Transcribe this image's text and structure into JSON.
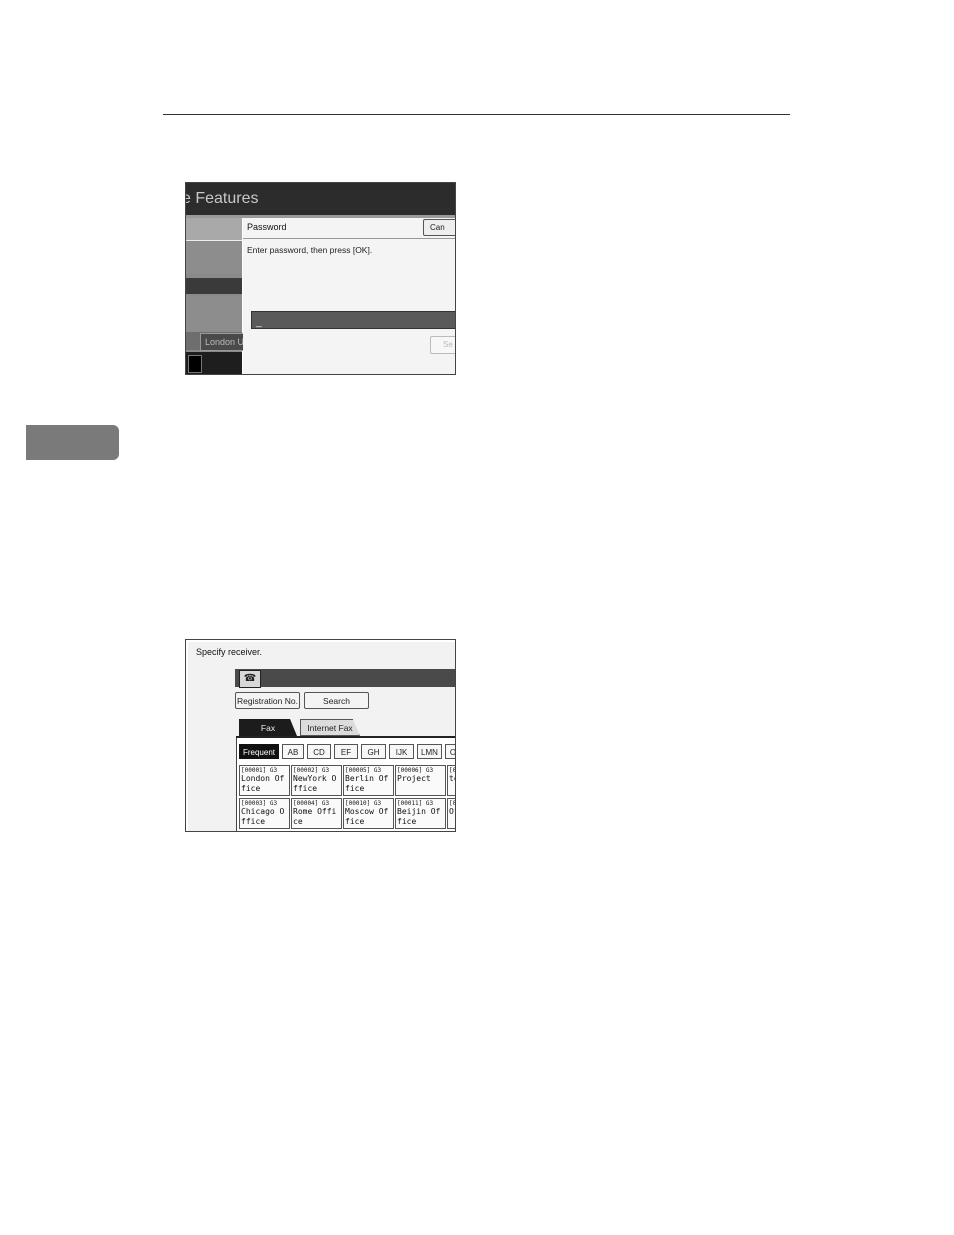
{
  "screenshot1": {
    "title": "e Features",
    "left_item": "London U",
    "dialog_title": "Password",
    "cancel_label": "Can",
    "prompt": "Enter password, then press [OK].",
    "input_value": "_",
    "secondary_button": "Se"
  },
  "screenshot2": {
    "instruction": "Specify receiver.",
    "fax_icon": "fax-machine-icon",
    "registration_button": "Registration No.",
    "search_button": "Search",
    "tabs": [
      "Fax",
      "Internet Fax"
    ],
    "index_tabs": [
      "Frequent",
      "AB",
      "CD",
      "EF",
      "GH",
      "IJK",
      "LMN",
      "O"
    ],
    "entries": [
      {
        "no": "[00001] G3",
        "name": "London Office"
      },
      {
        "no": "[00002] G3",
        "name": "NewYork Office"
      },
      {
        "no": "[00005] G3",
        "name": "Berlin Office"
      },
      {
        "no": "[00006] G3",
        "name": "Project"
      },
      {
        "no": "[0",
        "name": "te c"
      },
      {
        "no": "[00003] G3",
        "name": "Chicago Office"
      },
      {
        "no": "[00004] G3",
        "name": "Rome Office"
      },
      {
        "no": "[00010] G3",
        "name": "Moscow Office"
      },
      {
        "no": "[00011] G3",
        "name": "Beijin Office"
      },
      {
        "no": "[0",
        "name": "Of c"
      }
    ]
  }
}
